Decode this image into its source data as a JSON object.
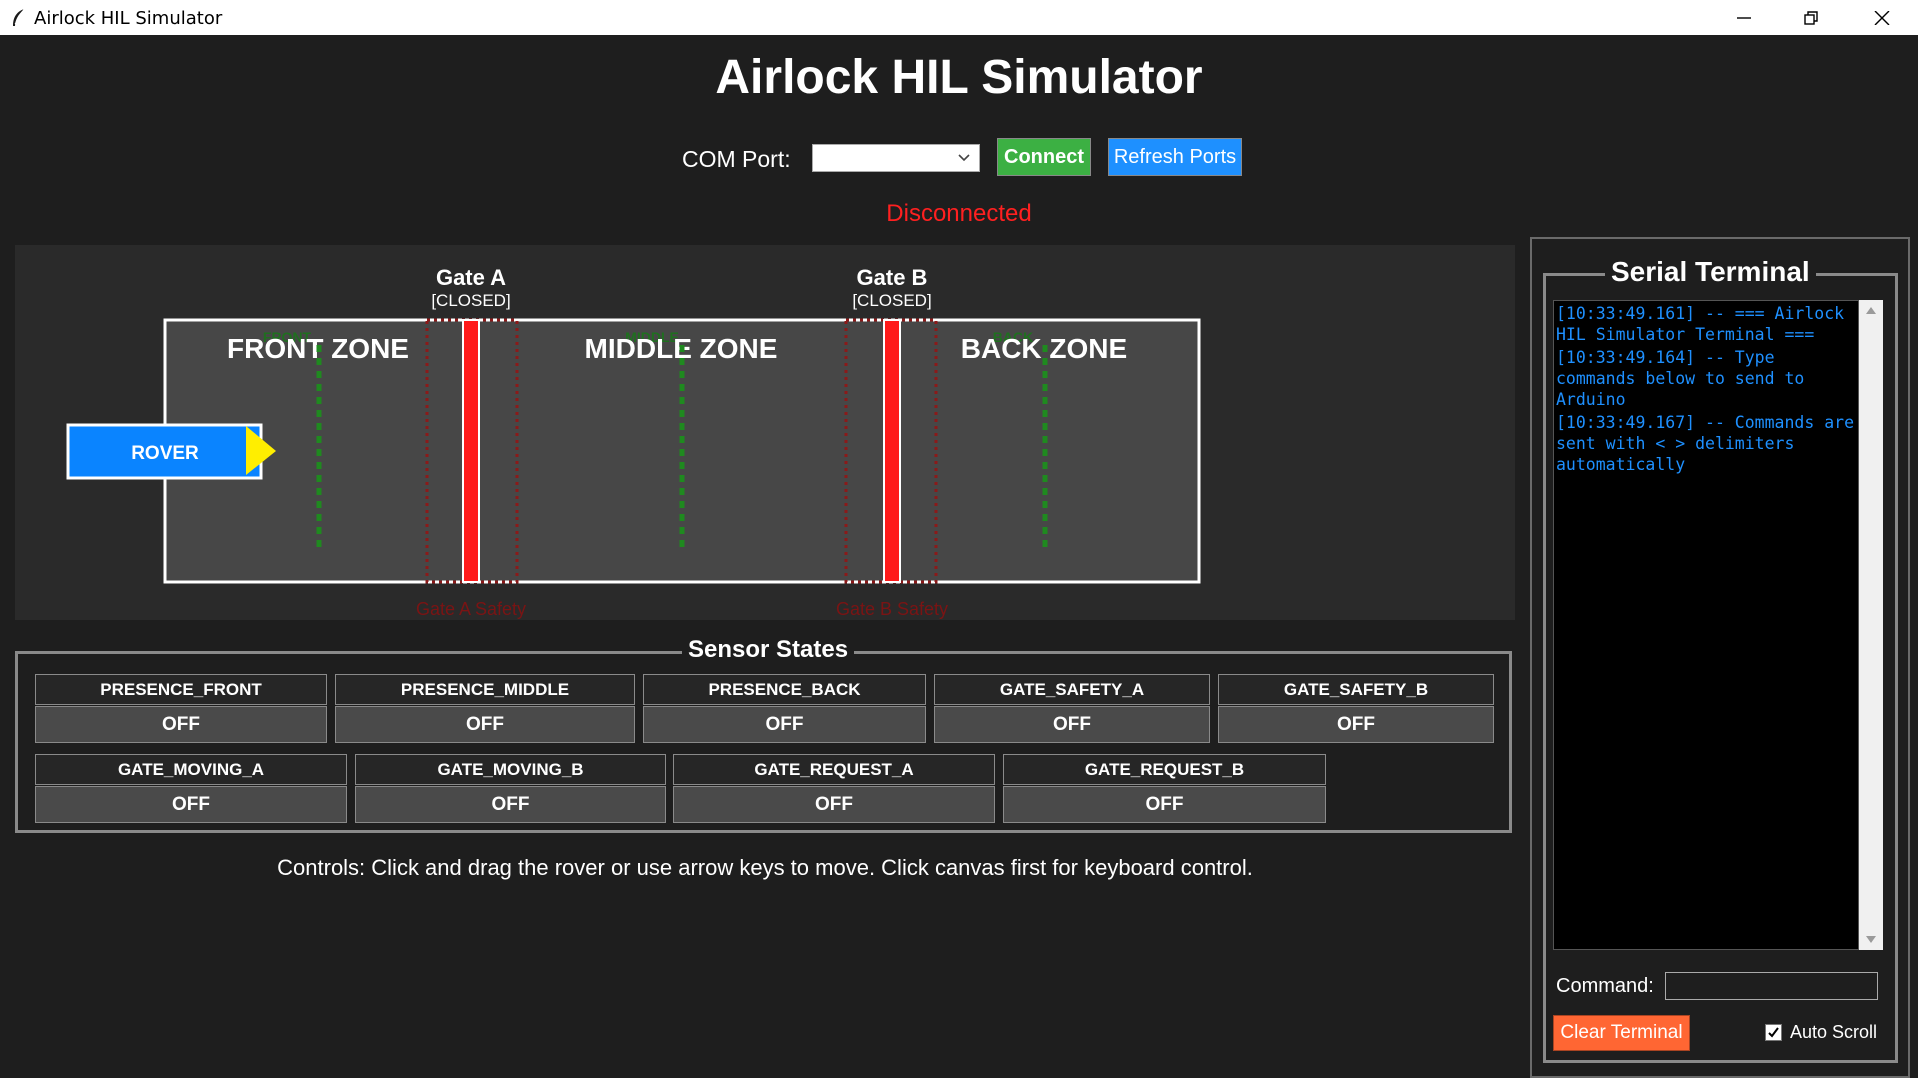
{
  "window": {
    "title": "Airlock HIL Simulator"
  },
  "header": {
    "title": "Airlock HIL Simulator",
    "com_port_label": "COM Port:",
    "com_port_value": "",
    "connect_label": "Connect",
    "refresh_label": "Refresh Ports",
    "status": "Disconnected"
  },
  "canvas": {
    "gate_a": {
      "name": "Gate A",
      "state": "[CLOSED]",
      "safety_label": "Gate A Safety"
    },
    "gate_b": {
      "name": "Gate B",
      "state": "[CLOSED]",
      "safety_label": "Gate B Safety"
    },
    "zones": [
      {
        "label": "FRONT ZONE",
        "sensor_label": "FRONT"
      },
      {
        "label": "MIDDLE ZONE",
        "sensor_label": "MIDDLE"
      },
      {
        "label": "BACK ZONE",
        "sensor_label": "BACK"
      }
    ],
    "rover_label": "ROVER"
  },
  "sensors": {
    "title": "Sensor States",
    "row1": [
      {
        "name": "PRESENCE_FRONT",
        "value": "OFF"
      },
      {
        "name": "PRESENCE_MIDDLE",
        "value": "OFF"
      },
      {
        "name": "PRESENCE_BACK",
        "value": "OFF"
      },
      {
        "name": "GATE_SAFETY_A",
        "value": "OFF"
      },
      {
        "name": "GATE_SAFETY_B",
        "value": "OFF"
      }
    ],
    "row2": [
      {
        "name": "GATE_MOVING_A",
        "value": "OFF"
      },
      {
        "name": "GATE_MOVING_B",
        "value": "OFF"
      },
      {
        "name": "GATE_REQUEST_A",
        "value": "OFF"
      },
      {
        "name": "GATE_REQUEST_B",
        "value": "OFF"
      }
    ]
  },
  "controls_hint": "Controls: Click and drag the rover or use arrow keys to move. Click canvas first for keyboard control.",
  "terminal": {
    "title": "Serial Terminal",
    "lines": [
      "[10:33:49.161] -- === Airlock HIL Simulator Terminal ===",
      "[10:33:49.164] -- Type commands below to send to Arduino",
      "[10:33:49.167] -- Commands are sent with < > delimiters automatically"
    ],
    "command_label": "Command:",
    "command_value": "",
    "clear_label": "Clear Terminal",
    "autoscroll_label": "Auto Scroll",
    "autoscroll_checked": true
  },
  "colors": {
    "connect": "#3cb043",
    "refresh": "#1e90ff",
    "status": "#ff2020",
    "gate_closed": "#ff1a1a",
    "sensor_line": "#1f8a1f",
    "rover": "#0a84ff",
    "rover_arrow": "#ffee00",
    "terminal_text": "#1e90ff",
    "clear_button": "#ff6633"
  }
}
